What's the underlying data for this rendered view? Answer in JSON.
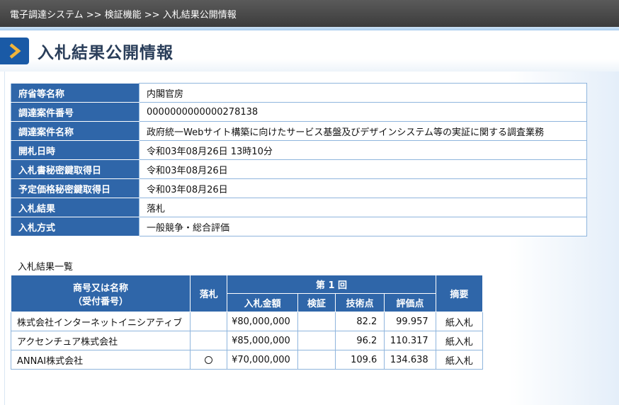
{
  "breadcrumb": {
    "text": "電子調達システム >> 検証機能 >> 入札結果公開情報"
  },
  "page": {
    "title": "入札結果公開情報"
  },
  "info": {
    "rows": [
      {
        "label": "府省等名称",
        "value": "内閣官房"
      },
      {
        "label": "調達案件番号",
        "value": "0000000000000278138"
      },
      {
        "label": "調達案件名称",
        "value": "政府統一Webサイト構築に向けたサービス基盤及びデザインシステム等の実証に関する調査業務"
      },
      {
        "label": "開札日時",
        "value": "令和03年08月26日 13時10分"
      },
      {
        "label": "入札書秘密鍵取得日",
        "value": "令和03年08月26日"
      },
      {
        "label": "予定価格秘密鍵取得日",
        "value": "令和03年08月26日"
      },
      {
        "label": "入札結果",
        "value": "落札"
      },
      {
        "label": "入札方式",
        "value": "一般競争・総合評価"
      }
    ]
  },
  "results": {
    "section_title": "入札結果一覧",
    "headers": {
      "name_line1": "商号又は名称",
      "name_line2": "（受付番号）",
      "award": "落札",
      "round": "第 1 回",
      "amount": "入札金額",
      "verify": "検証",
      "tech": "技術点",
      "eval": "評価点",
      "remarks": "摘要"
    },
    "rows": [
      {
        "name": "株式会社インターネットイニシアティブ",
        "award": "",
        "amount": "¥80,000,000",
        "verify": "",
        "tech": "82.2",
        "eval": "99.957",
        "remarks": "紙入札"
      },
      {
        "name": "アクセンチュア株式会社",
        "award": "",
        "amount": "¥85,000,000",
        "verify": "",
        "tech": "96.2",
        "eval": "110.317",
        "remarks": "紙入札"
      },
      {
        "name": "ANNAI株式会社",
        "award": "circle",
        "amount": "¥70,000,000",
        "verify": "",
        "tech": "109.6",
        "eval": "134.638",
        "remarks": "紙入札"
      }
    ]
  },
  "colors": {
    "header_blue": "#2f66a9",
    "border_blue": "#8fb5dd",
    "topbar": "#4a4a4a",
    "arrow_blue": "#1a5aa6"
  }
}
